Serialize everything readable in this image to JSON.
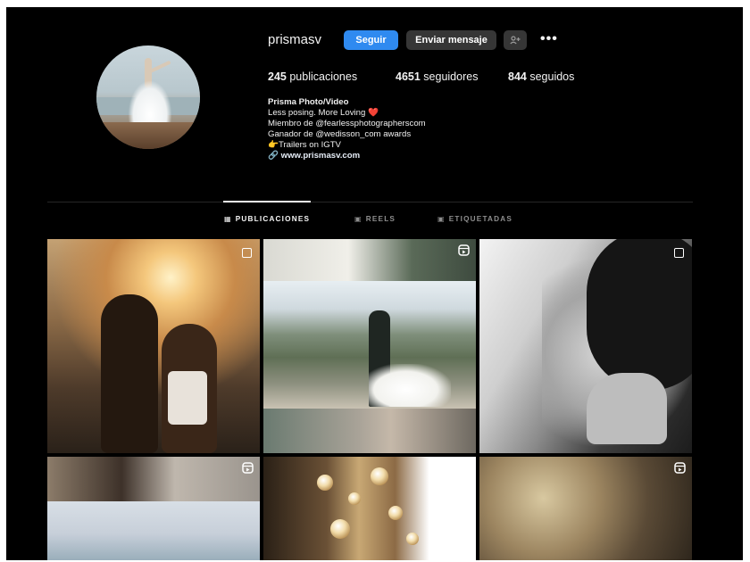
{
  "profile": {
    "username": "prismasv",
    "follow_label": "Seguir",
    "message_label": "Enviar mensaje",
    "suggest_icon": "add-person-icon",
    "more_label": "•••"
  },
  "stats": {
    "posts_count": "245",
    "posts_label": "publicaciones",
    "followers_count": "4651",
    "followers_label": "seguidores",
    "following_count": "844",
    "following_label": "seguidos"
  },
  "bio": {
    "name": "Prisma Photo/Video",
    "line1": "Less posing. More Loving ❤️",
    "line2": "Miembro de @fearlessphotographerscom",
    "line3": "Ganador de @wedisson_com awards",
    "line4": "👉Trailers on IGTV",
    "link_icon": "🔗",
    "link": "www.prismasv.com"
  },
  "tabs": [
    {
      "label": "PUBLICACIONES",
      "icon": "grid-icon",
      "glyph": "▦",
      "active": true
    },
    {
      "label": "REELS",
      "icon": "reels-icon",
      "glyph": "▣",
      "active": false
    },
    {
      "label": "ETIQUETADAS",
      "icon": "tagged-icon",
      "glyph": "▣",
      "active": false
    }
  ],
  "posts": [
    {
      "type": "carousel",
      "icon": "carousel-icon",
      "subject": "couple at sunset"
    },
    {
      "type": "reel",
      "icon": "reel-icon",
      "subject": "wedding couple on lawn"
    },
    {
      "type": "carousel",
      "icon": "carousel-icon",
      "subject": "bride putting on earring"
    },
    {
      "type": "reel",
      "icon": "reel-icon",
      "subject": "couple on beach"
    },
    {
      "type": "image",
      "icon": "",
      "subject": "chandeliers"
    },
    {
      "type": "reel",
      "icon": "reel-icon",
      "subject": "decorated venue"
    }
  ],
  "colors": {
    "background": "#000000",
    "follow_button": "#2f8af0",
    "secondary_button": "#363636",
    "muted_text": "#8e8e8e"
  }
}
